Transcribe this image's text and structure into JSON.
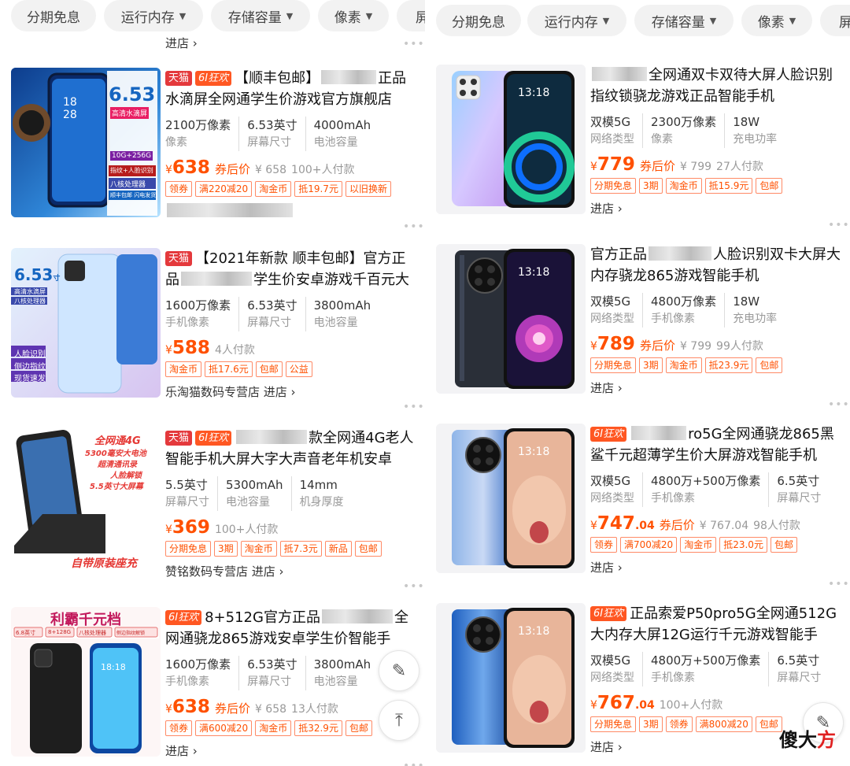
{
  "left": {
    "filters": [
      {
        "label": "分期免息",
        "has_caret": false
      },
      {
        "label": "运行内存",
        "has_caret": true
      },
      {
        "label": "存储容量",
        "has_caret": true
      },
      {
        "label": "像素",
        "has_caret": true
      },
      {
        "label": "屏",
        "has_caret": false
      }
    ],
    "top_store": "进店 ›",
    "products": [
      {
        "tags": [
          "天猫",
          "6I狂欢"
        ],
        "title_a": "【顺丰包邮】",
        "title_b": "正品水滴屏全网通学生价游戏官方旗舰店",
        "specs": [
          {
            "v": "2100万像素",
            "l": "像素"
          },
          {
            "v": "6.53英寸",
            "l": "屏幕尺寸"
          },
          {
            "v": "4000mAh",
            "l": "电池容量"
          }
        ],
        "price": "638",
        "price_dec": "",
        "after_coupon": "券后价",
        "orig": "¥ 658",
        "buyers": "100+人付款",
        "badges": [
          "领券",
          "满220减20",
          "淘金币",
          "抵19.7元",
          "以旧换新"
        ],
        "store": "",
        "thumb_text": [
          "6.53",
          "高清水滴屏",
          "10G+256G",
          "指纹+人脸识别",
          "八核处理器",
          "顺丰包邮 闪电发货",
          "18",
          "28"
        ]
      },
      {
        "tags": [
          "天猫"
        ],
        "title_a": "【2021年新款 顺丰包邮】官方正品",
        "title_b": "学生价安卓游戏千百元大",
        "specs": [
          {
            "v": "1600万像素",
            "l": "手机像素"
          },
          {
            "v": "6.53英寸",
            "l": "屏幕尺寸"
          },
          {
            "v": "3800mAh",
            "l": "电池容量"
          }
        ],
        "price": "588",
        "price_dec": "",
        "after_coupon": "",
        "orig": "",
        "buyers": "4人付款",
        "badges": [
          "淘金币",
          "抵17.6元",
          "包邮",
          "公益"
        ],
        "store": "乐淘猫数码专营店 进店 ›",
        "thumb_text": [
          "6.53",
          "寸",
          "高清水滴屏",
          "八核处理器",
          "人脸识别",
          "侧边指纹",
          "现货速发"
        ]
      },
      {
        "tags": [
          "天猫",
          "6I狂欢"
        ],
        "title_a": "款全网通4G老人智能手机大屏大字大声音老年机安卓",
        "title_b": "",
        "specs": [
          {
            "v": "5.5英寸",
            "l": "屏幕尺寸"
          },
          {
            "v": "5300mAh",
            "l": "电池容量"
          },
          {
            "v": "14mm",
            "l": "机身厚度"
          }
        ],
        "price": "369",
        "price_dec": "",
        "after_coupon": "",
        "orig": "",
        "buyers": "100+人付款",
        "badges": [
          "分期免息",
          "3期",
          "淘金币",
          "抵7.3元",
          "新品",
          "包邮"
        ],
        "store": "赞铭数码专营店 进店 ›",
        "thumb_text": [
          "全网通4G",
          "5300毫安大电池",
          "超清通讯录",
          "人脸解锁",
          "5.5英寸大屏幕",
          "自带原装座充"
        ]
      },
      {
        "tags": [
          "6I狂欢"
        ],
        "title_a": "8+512G官方正品",
        "title_b": "全网通骁龙865游戏安卓学生价智能手",
        "specs": [
          {
            "v": "1600万像素",
            "l": "手机像素"
          },
          {
            "v": "6.53英寸",
            "l": "屏幕尺寸"
          },
          {
            "v": "3800mAh",
            "l": "电池容量"
          }
        ],
        "price": "638",
        "price_dec": "",
        "after_coupon": "券后价",
        "orig": "¥ 658",
        "buyers": "13人付款",
        "badges": [
          "领券",
          "满600减20",
          "淘金币",
          "抵32.9元",
          "包邮"
        ],
        "store": "进店 ›",
        "thumb_text": [
          "利霸千元档",
          "6.8英寸",
          "8+128G",
          "八核处理器",
          "侧边指纹解锁",
          "18:18"
        ]
      }
    ]
  },
  "right": {
    "filters": [
      {
        "label": "分期免息",
        "has_caret": false
      },
      {
        "label": "运行内存",
        "has_caret": true
      },
      {
        "label": "存储容量",
        "has_caret": true
      },
      {
        "label": "像素",
        "has_caret": true
      },
      {
        "label": "屏",
        "has_caret": false
      }
    ],
    "products": [
      {
        "tags": [],
        "title_a": "全网通双卡双待大屏人脸识别指纹锁骁龙游戏正品智能手机",
        "title_b": "",
        "specs": [
          {
            "v": "双模5G",
            "l": "网络类型"
          },
          {
            "v": "2300万像素",
            "l": "像素"
          },
          {
            "v": "18W",
            "l": "充电功率"
          }
        ],
        "price": "779",
        "price_dec": "",
        "after_coupon": "券后价",
        "orig": "¥ 799",
        "buyers": "27人付款",
        "badges": [
          "分期免息",
          "3期",
          "淘金币",
          "抵15.9元",
          "包邮"
        ],
        "store": "进店 ›",
        "thumb_text": [
          "13:18"
        ]
      },
      {
        "tags": [],
        "title_a": "官方正品",
        "title_b": "人脸识别双卡大屏大内存骁龙865游戏智能手机",
        "specs": [
          {
            "v": "双模5G",
            "l": "网络类型"
          },
          {
            "v": "4800万像素",
            "l": "手机像素"
          },
          {
            "v": "18W",
            "l": "充电功率"
          }
        ],
        "price": "789",
        "price_dec": "",
        "after_coupon": "券后价",
        "orig": "¥ 799",
        "buyers": "99人付款",
        "badges": [
          "分期免息",
          "3期",
          "淘金币",
          "抵23.9元",
          "包邮"
        ],
        "store": "进店 ›",
        "thumb_text": [
          "13:18"
        ]
      },
      {
        "tags": [
          "6I狂欢"
        ],
        "title_a": "ro5G全网通骁龙865",
        "title_b": "黑鲨千元超薄学生价大屏游戏智能手机",
        "specs": [
          {
            "v": "双模5G",
            "l": "网络类型"
          },
          {
            "v": "4800万+500万像素",
            "l": "手机像素"
          },
          {
            "v": "6.5英寸",
            "l": "屏幕尺寸"
          }
        ],
        "price": "747",
        "price_dec": ".04",
        "after_coupon": "券后价",
        "orig": "¥ 767.04",
        "buyers": "98人付款",
        "badges": [
          "领券",
          "满700减20",
          "淘金币",
          "抵23.0元",
          "包邮"
        ],
        "store": "进店 ›",
        "thumb_text": [
          "13:18"
        ]
      },
      {
        "tags": [
          "6I狂欢"
        ],
        "title_a": "正品索爱P50pro5G全网通512G大内存大屏12G运行千元游戏智能手",
        "title_b": "",
        "specs": [
          {
            "v": "双模5G",
            "l": "网络类型"
          },
          {
            "v": "4800万+500万像素",
            "l": "手机像素"
          },
          {
            "v": "6.5英寸",
            "l": "屏幕尺寸"
          }
        ],
        "price": "767",
        "price_dec": ".04",
        "after_coupon": "",
        "orig": "",
        "buyers": "100+人付款",
        "badges": [
          "分期免息",
          "3期",
          "领券",
          "满800减20",
          "包邮"
        ],
        "store": "进店 ›",
        "thumb_text": [
          "13:18"
        ]
      }
    ]
  },
  "watermark": {
    "black": "傻大",
    "red": "方"
  },
  "icons": {
    "feedback": "edit-icon",
    "back_to_top": "arrow-up-icon"
  }
}
